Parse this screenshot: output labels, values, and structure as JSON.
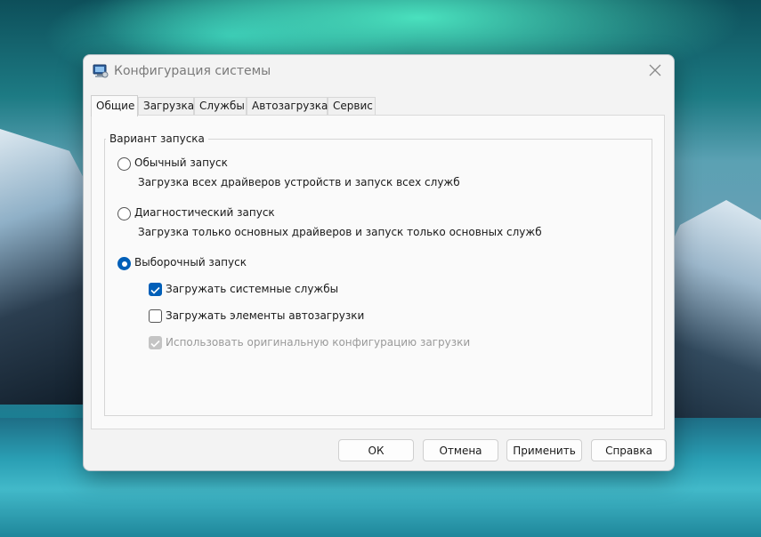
{
  "window": {
    "title": "Конфигурация системы",
    "icon": "msconfig-icon"
  },
  "tabs": [
    {
      "label": "Общие",
      "active": true
    },
    {
      "label": "Загрузка",
      "active": false
    },
    {
      "label": "Службы",
      "active": false
    },
    {
      "label": "Автозагрузка",
      "active": false
    },
    {
      "label": "Сервис",
      "active": false
    }
  ],
  "startup": {
    "group_label": "Вариант запуска",
    "normal": {
      "label": "Обычный запуск",
      "description": "Загрузка всех драйверов устройств и запуск всех служб",
      "selected": false
    },
    "diagnostic": {
      "label": "Диагностический запуск",
      "description": "Загрузка только основных драйверов и запуск только основных служб",
      "selected": false
    },
    "selective": {
      "label": "Выборочный запуск",
      "selected": true,
      "options": {
        "system_services": {
          "label": "Загружать системные службы",
          "checked": true,
          "enabled": true
        },
        "startup_items": {
          "label": "Загружать элементы автозагрузки",
          "checked": false,
          "enabled": true
        },
        "original_boot": {
          "label": "Использовать оригинальную конфигурацию загрузки",
          "checked": true,
          "enabled": false
        }
      }
    }
  },
  "buttons": {
    "ok": "ОК",
    "cancel": "Отмена",
    "apply": "Применить",
    "help": "Справка"
  },
  "colors": {
    "accent": "#005fb8",
    "dialog_bg": "#f3f3f3"
  }
}
